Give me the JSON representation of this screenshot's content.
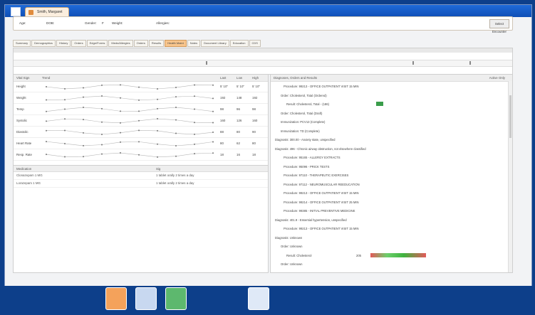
{
  "window": {
    "tab_label": "Smith, Margaret"
  },
  "patient_bar": {
    "age_label": "Age:",
    "dob_label": "DOB:",
    "gender_label": "Gender:",
    "gender_value": "F",
    "weight_label": "Weight:",
    "allergies_label": "Allergies:",
    "button_label": "Select Encounter"
  },
  "tabs": [
    "Summary",
    "Demographics",
    "History",
    "Orders",
    "Edge/Forms",
    "Meds/Allergies",
    "Orders",
    "Results",
    "Health Maint",
    "Notes",
    "Document Library",
    "Education",
    "CDS"
  ],
  "active_tab_index": 8,
  "vitals": {
    "headers": {
      "vital_sign": "Vital Sign",
      "trend": "Trend",
      "last": "Last",
      "low": "Low",
      "high": "High"
    },
    "rows": [
      {
        "name": "Height",
        "last": "5' 10\"",
        "low": "5' 10\"",
        "high": "5' 10\""
      },
      {
        "name": "Weight",
        "last": "192",
        "low": "148",
        "high": "192"
      },
      {
        "name": "Temp",
        "last": "98",
        "low": "96",
        "high": "98"
      },
      {
        "name": "Systolic",
        "last": "160",
        "low": "126",
        "high": "160"
      },
      {
        "name": "Diastolic",
        "last": "88",
        "low": "80",
        "high": "90"
      },
      {
        "name": "Heart Rate",
        "last": "80",
        "low": "62",
        "high": "80"
      },
      {
        "name": "Resp. Rate",
        "last": "18",
        "low": "16",
        "high": "18"
      }
    ]
  },
  "medications": {
    "headers": {
      "medication": "Medication",
      "sig": "Sig"
    },
    "rows": [
      {
        "name": "Clonazepam 1 MG",
        "sig": "1 tablet orally 2 times a day"
      },
      {
        "name": "Lorazepam 1 MG",
        "sig": "1 tablet orally 2 times a day"
      }
    ]
  },
  "results_panel": {
    "header": "Diagnoses, Orders and Results",
    "active_only": "Active Only",
    "lines": [
      "Procedure: 99213 - OFFICE OUTPATIENT VISIT 15 MIN",
      "Order: Cholesterol, Total (Ordered)",
      "Result: Cholesterol, Total - (186)",
      "Order: Cholesterol, Total (Draft)",
      "Immunization: PCV13 (Complete)",
      "Immunization: TD (Complete)",
      "Diagnosis: 300.00 - Anxiety state, unspecified",
      "Diagnosis: 496 - Chronic airway obstruction, not elsewhere classified",
      "Procedure: 95165 - ALLERGY EXTRACTS",
      "Procedure: 95096 - PRICK TESTS",
      "Procedure: 97110 - THERAPEUTIC EXERCISES",
      "Procedure: 97112 - NEUROMUSCULAR REEDUCATION",
      "Procedure: 99213 - OFFICE OUTPATIENT VISIT 15 MIN",
      "Procedure: 99214 - OFFICE OUTPATIENT VISIT 25 MIN",
      "Procedure: 99385 - INITIAL PREVENTIVE MEDICINE",
      "Diagnosis: 401.9 - Essential hypertension, unspecified",
      "Procedure: 99213 - OFFICE OUTPATIENT VISIT 15 MIN",
      "Diagnosis: Unknown",
      "Order: Unknown",
      "Result: Cholesterol",
      "Order: Unknown"
    ],
    "result_value": "205"
  }
}
